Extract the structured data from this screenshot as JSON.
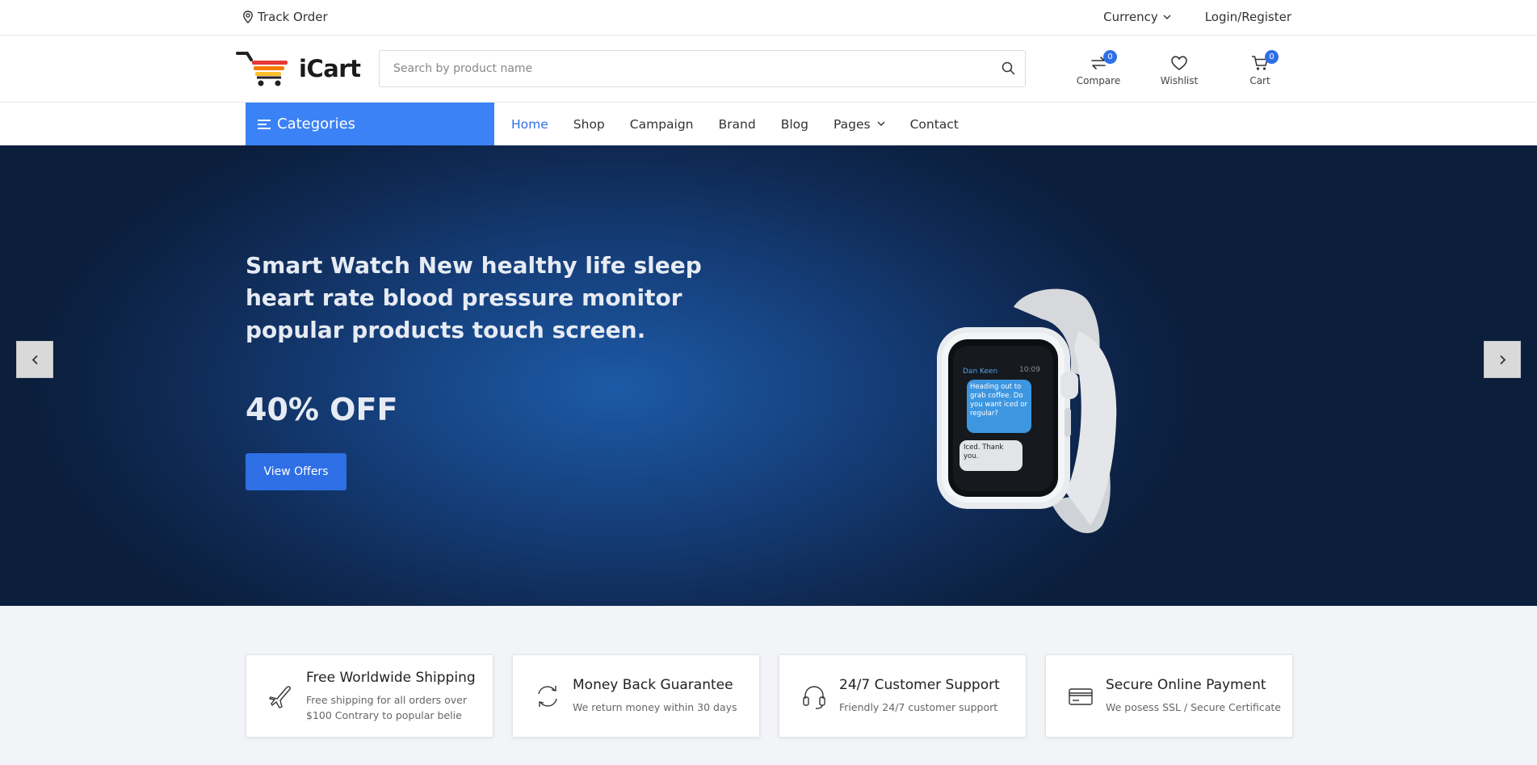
{
  "topbar": {
    "track_order": "Track Order",
    "currency": "Currency",
    "login": "Login/Register"
  },
  "header": {
    "logo_text": "iCart",
    "search_placeholder": "Search by product name",
    "compare": {
      "label": "Compare",
      "count": "0"
    },
    "wishlist": {
      "label": "Wishlist"
    },
    "cart": {
      "label": "Cart",
      "count": "0"
    }
  },
  "nav": {
    "categories": "Categories",
    "items": [
      {
        "label": "Home",
        "active": true
      },
      {
        "label": "Shop"
      },
      {
        "label": "Campaign"
      },
      {
        "label": "Brand"
      },
      {
        "label": "Blog"
      },
      {
        "label": "Pages"
      },
      {
        "label": "Contact"
      }
    ]
  },
  "hero": {
    "headline": "Smart Watch New healthy life sleep heart rate blood pressure monitor popular products touch screen.",
    "discount": "40% OFF",
    "cta": "View Offers",
    "watch_screen": {
      "contact": "Dan Keen",
      "time": "10:09",
      "message_1": "Heading out to grab coffee. Do you want iced or regular?",
      "message_2": "Iced. Thank you."
    }
  },
  "features": [
    {
      "icon": "airplane-icon",
      "title": "Free Worldwide Shipping",
      "desc": "Free shipping for all orders over $100 Contrary to popular belie"
    },
    {
      "icon": "refresh-icon",
      "title": "Money Back Guarantee",
      "desc": "We return money within 30 days"
    },
    {
      "icon": "headset-icon",
      "title": "24/7 Customer Support",
      "desc": "Friendly 24/7 customer support"
    },
    {
      "icon": "credit-card-icon",
      "title": "Secure Online Payment",
      "desc": "We posess SSL / Secure Certificate"
    }
  ],
  "colors": {
    "accent": "#3b82f6",
    "button": "#2f6fe6",
    "hero_bg": "#153d78",
    "features_bg": "#f2f4f8"
  }
}
